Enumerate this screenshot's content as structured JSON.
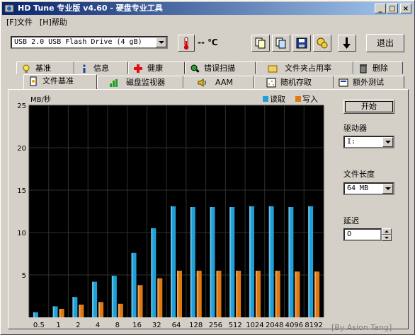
{
  "window": {
    "title": "HD Tune 专业版 v4.60 - 硬盘专业工具",
    "controls": {
      "minimize": "_",
      "maximize": "□",
      "close": "×"
    }
  },
  "menu": [
    {
      "label": "[F]文件"
    },
    {
      "label": "[H]帮助"
    }
  ],
  "toolbar": {
    "drive": "USB 2.0 USB Flash Drive  (4 gB)",
    "temperature": "-- ℃",
    "exit_label": "退出",
    "icons": [
      "thermometer-icon",
      "copy-info-icon",
      "copy-screen-icon",
      "save-icon",
      "options-icon",
      "download-icon"
    ]
  },
  "tabs_top": [
    {
      "label": "基准",
      "icon": "lightbulb-icon"
    },
    {
      "label": "信息",
      "icon": "info-icon"
    },
    {
      "label": "健康",
      "icon": "health-cross-icon"
    },
    {
      "label": "错误扫描",
      "icon": "scan-icon"
    },
    {
      "label": "文件夹占用率",
      "icon": "folder-icon"
    },
    {
      "label": "删除",
      "icon": "trash-icon"
    }
  ],
  "tabs_bottom": [
    {
      "label": "文件基准",
      "icon": "file-icon",
      "active": true
    },
    {
      "label": "磁盘监视器",
      "icon": "monitor-chart-icon"
    },
    {
      "label": "AAM",
      "icon": "speaker-icon"
    },
    {
      "label": "随机存取",
      "icon": "random-access-icon"
    },
    {
      "label": "额外测试",
      "icon": "extra-test-icon"
    }
  ],
  "side": {
    "start_label": "开始",
    "drive_label": "驱动器",
    "drive_value": "I:",
    "file_length_label": "文件长度",
    "file_length_value": "64 MB",
    "delay_label": "延迟",
    "delay_value": "0"
  },
  "chart_data": {
    "type": "bar",
    "ylabel": "MB/秒",
    "ylim": [
      0,
      25
    ],
    "yticks": [
      5,
      10,
      15,
      20,
      25
    ],
    "categories": [
      "0.5",
      "1",
      "2",
      "4",
      "8",
      "16",
      "32",
      "64",
      "128",
      "256",
      "512",
      "1024",
      "2048",
      "4096",
      "8192"
    ],
    "series": [
      {
        "name": "读取",
        "color": "#1fa0d8",
        "values": [
          0.6,
          1.3,
          2.4,
          4.2,
          4.9,
          7.6,
          10.5,
          13.1,
          13.0,
          13.0,
          13.0,
          13.1,
          13.1,
          13.0,
          13.1
        ]
      },
      {
        "name": "写入",
        "color": "#e07a10",
        "values": [
          0,
          1.0,
          1.5,
          1.8,
          1.6,
          3.8,
          4.6,
          5.5,
          5.5,
          5.5,
          5.5,
          5.5,
          5.5,
          5.4,
          5.4
        ]
      }
    ],
    "legend": "top-right",
    "grid": true
  },
  "watermark": "[By Asion Tang]"
}
